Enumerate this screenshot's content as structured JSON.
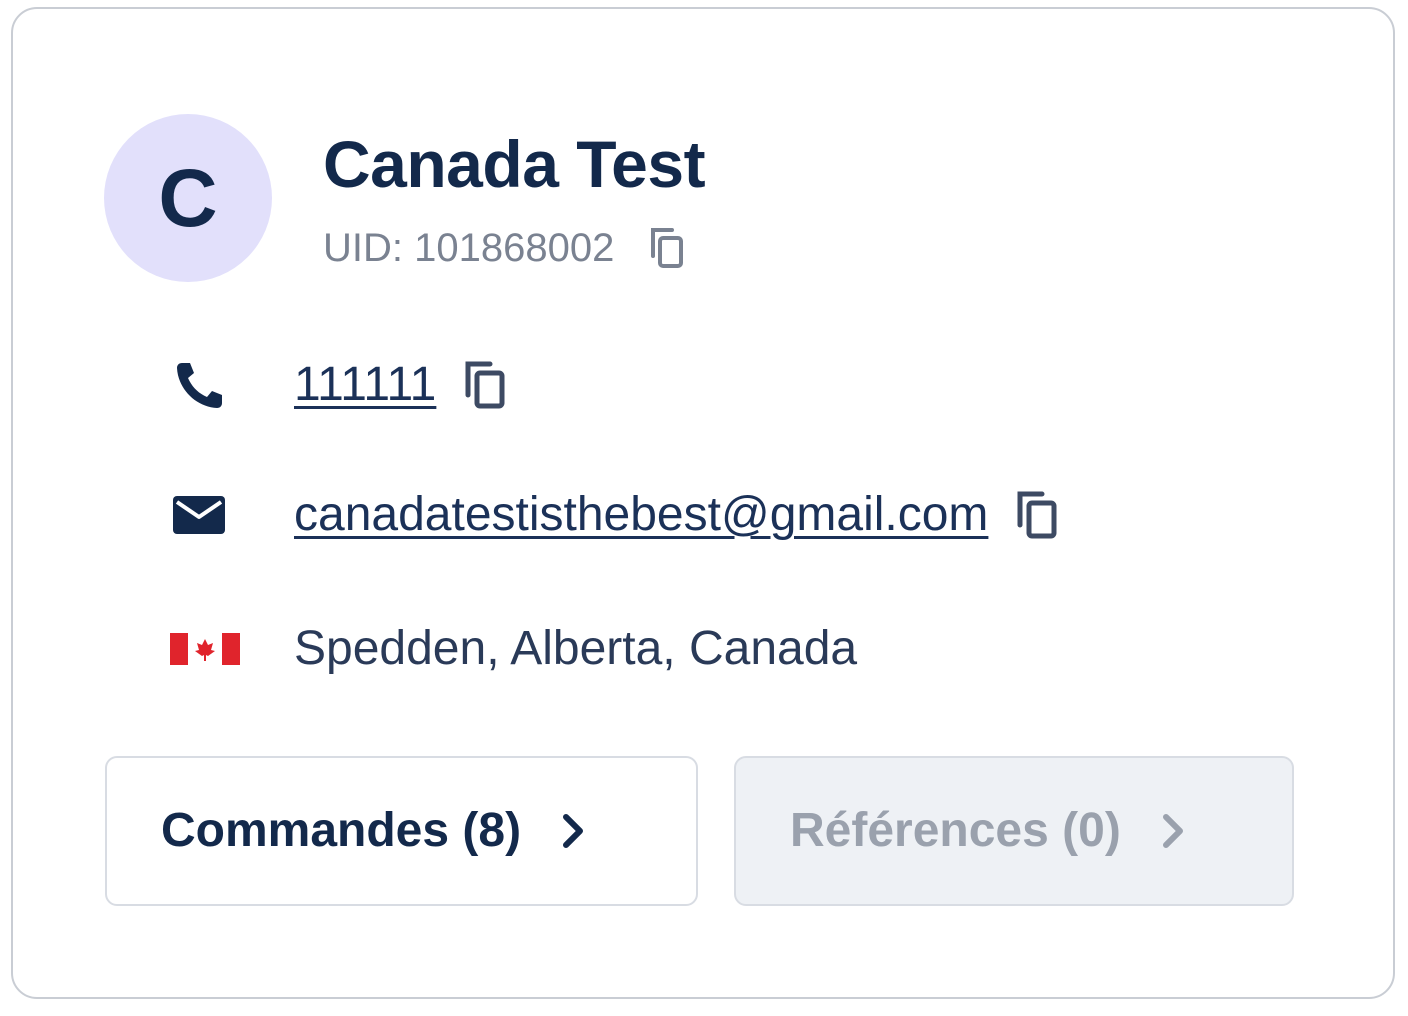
{
  "customer": {
    "avatar_initial": "C",
    "name": "Canada Test",
    "uid_label": "UID: 101868002"
  },
  "contact": {
    "phone": "111111",
    "email": "canadatestisthebest@gmail.com",
    "location": "Spedden, Alberta, Canada",
    "country_flag": "canada-flag"
  },
  "actions": {
    "orders_label": "Commandes (8)",
    "references_label": "Références (0)"
  },
  "colors": {
    "primary_text": "#13294b",
    "avatar_bg": "#e2e0fb",
    "muted_text": "#7a8291",
    "flag_red": "#e0242c"
  },
  "icons": {
    "copy": "copy-icon",
    "phone": "phone-icon",
    "email": "envelope-icon",
    "chevron": "chevron-right-icon"
  }
}
